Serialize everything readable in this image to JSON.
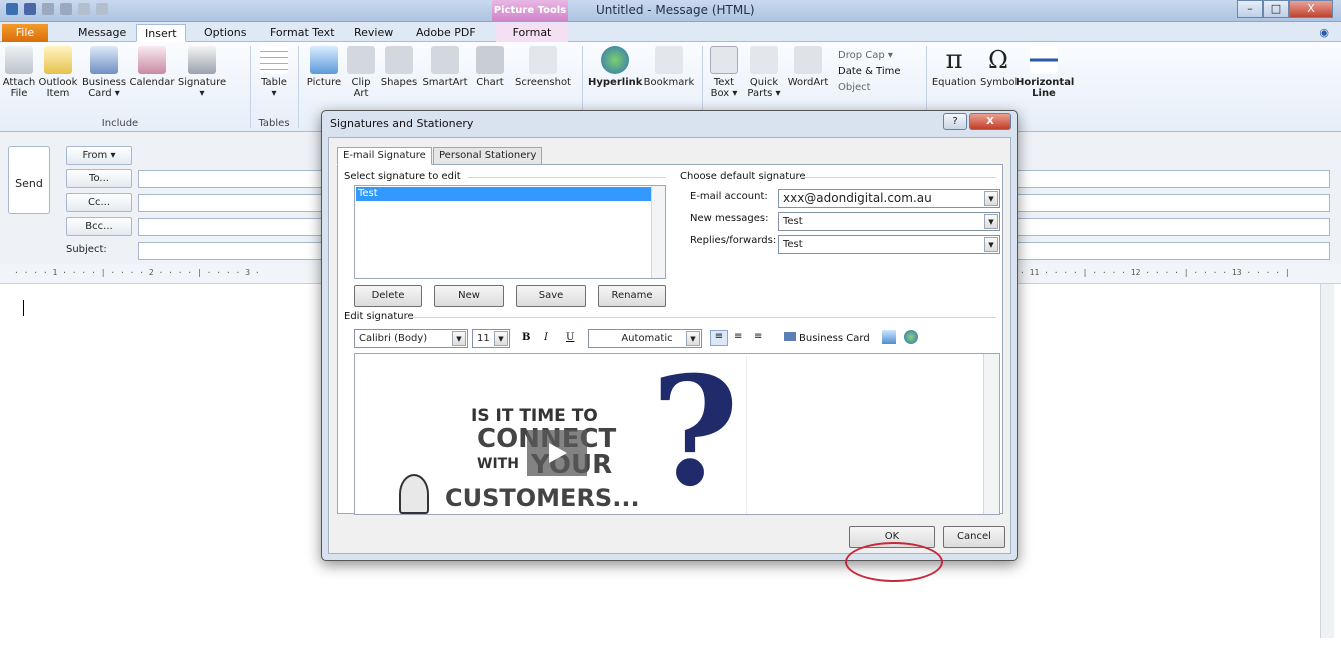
{
  "window": {
    "title": "Untitled - Message (HTML)",
    "context_tab": "Picture Tools",
    "minimize": "–",
    "maximize": "□",
    "close": "X"
  },
  "ribbon_tabs": [
    "File",
    "Message",
    "Insert",
    "Options",
    "Format Text",
    "Review",
    "Adobe PDF",
    "Format"
  ],
  "ribbon": {
    "include": [
      "Attach\nFile",
      "Outlook\nItem",
      "Business\nCard ▾",
      "Calendar",
      "Signature\n▾"
    ],
    "include_group": "Include",
    "tables_btn": "Table\n▾",
    "tables_group": "Tables",
    "illus": [
      "Picture",
      "Clip\nArt",
      "Shapes",
      "SmartArt",
      "Chart",
      "Screenshot"
    ],
    "links": [
      "Hyperlink",
      "Bookmark"
    ],
    "text": [
      "Text\nBox ▾",
      "Quick\nParts ▾",
      "WordArt"
    ],
    "text_small": [
      "Drop Cap ▾",
      "Date & Time",
      "Object"
    ],
    "symbols": [
      "Equation",
      "Symbol",
      "Horizontal\nLine"
    ]
  },
  "compose": {
    "send": "Send",
    "from": "From ▾",
    "to": "To...",
    "cc": "Cc...",
    "bcc": "Bcc...",
    "subject": "Subject:"
  },
  "ruler": {
    "left": "· · · · 1 · · · · | · · · · 2 · · · · | · · · · 3 ·",
    "right": "· 11 · · · · | · · · · 12 · · · · | · · · · 13 · · · · |"
  },
  "dialog": {
    "title": "Signatures and Stationery",
    "help": "?",
    "close": "X",
    "tabs": [
      "E-mail Signature",
      "Personal Stationery"
    ],
    "select_label": "Select signature to edit",
    "signatures": [
      "Test"
    ],
    "buttons": [
      "Delete",
      "New",
      "Save",
      "Rename"
    ],
    "default_label": "Choose default signature",
    "email_account_label": "E-mail account:",
    "email_account": "xxx@adondigital.com.au",
    "new_messages_label": "New messages:",
    "new_messages": "Test",
    "replies_label": "Replies/forwards:",
    "replies": "Test",
    "edit_label": "Edit signature",
    "font": "Calibri (Body)",
    "size": "11",
    "bold": "B",
    "italic": "I",
    "underline": "U",
    "color": "Automatic",
    "business_card": "Business Card",
    "banner": [
      "IS IT TIME TO",
      "CONNECT",
      "WITH",
      "YOUR",
      "CUSTOMERS..."
    ],
    "ok": "OK",
    "cancel": "Cancel"
  },
  "colors": {
    "accent": "#c9283a",
    "selection": "#3399ff",
    "file_tab": "#e27c15"
  }
}
